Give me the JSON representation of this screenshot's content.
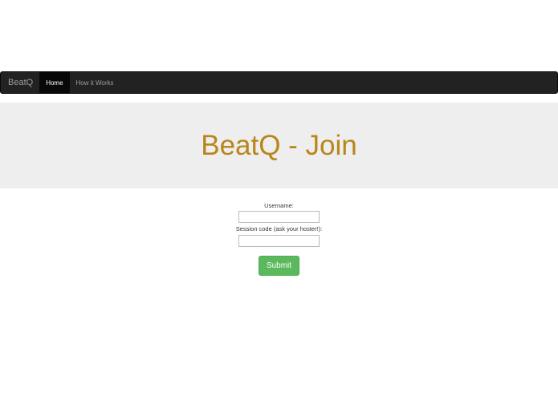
{
  "navbar": {
    "brand": "BeatQ",
    "items": [
      {
        "label": "Home",
        "active": true
      },
      {
        "label": "How it Works",
        "active": false
      }
    ]
  },
  "jumbotron": {
    "title": "BeatQ - Join"
  },
  "form": {
    "username_label": "Username:",
    "username_value": "",
    "session_label": "Session code (ask your hoster!):",
    "session_value": "",
    "submit_label": "Submit"
  },
  "colors": {
    "navbar_bg": "#222222",
    "title": "#b8861b",
    "jumbotron_bg": "#eeeeee",
    "submit_bg": "#5cb85c"
  }
}
